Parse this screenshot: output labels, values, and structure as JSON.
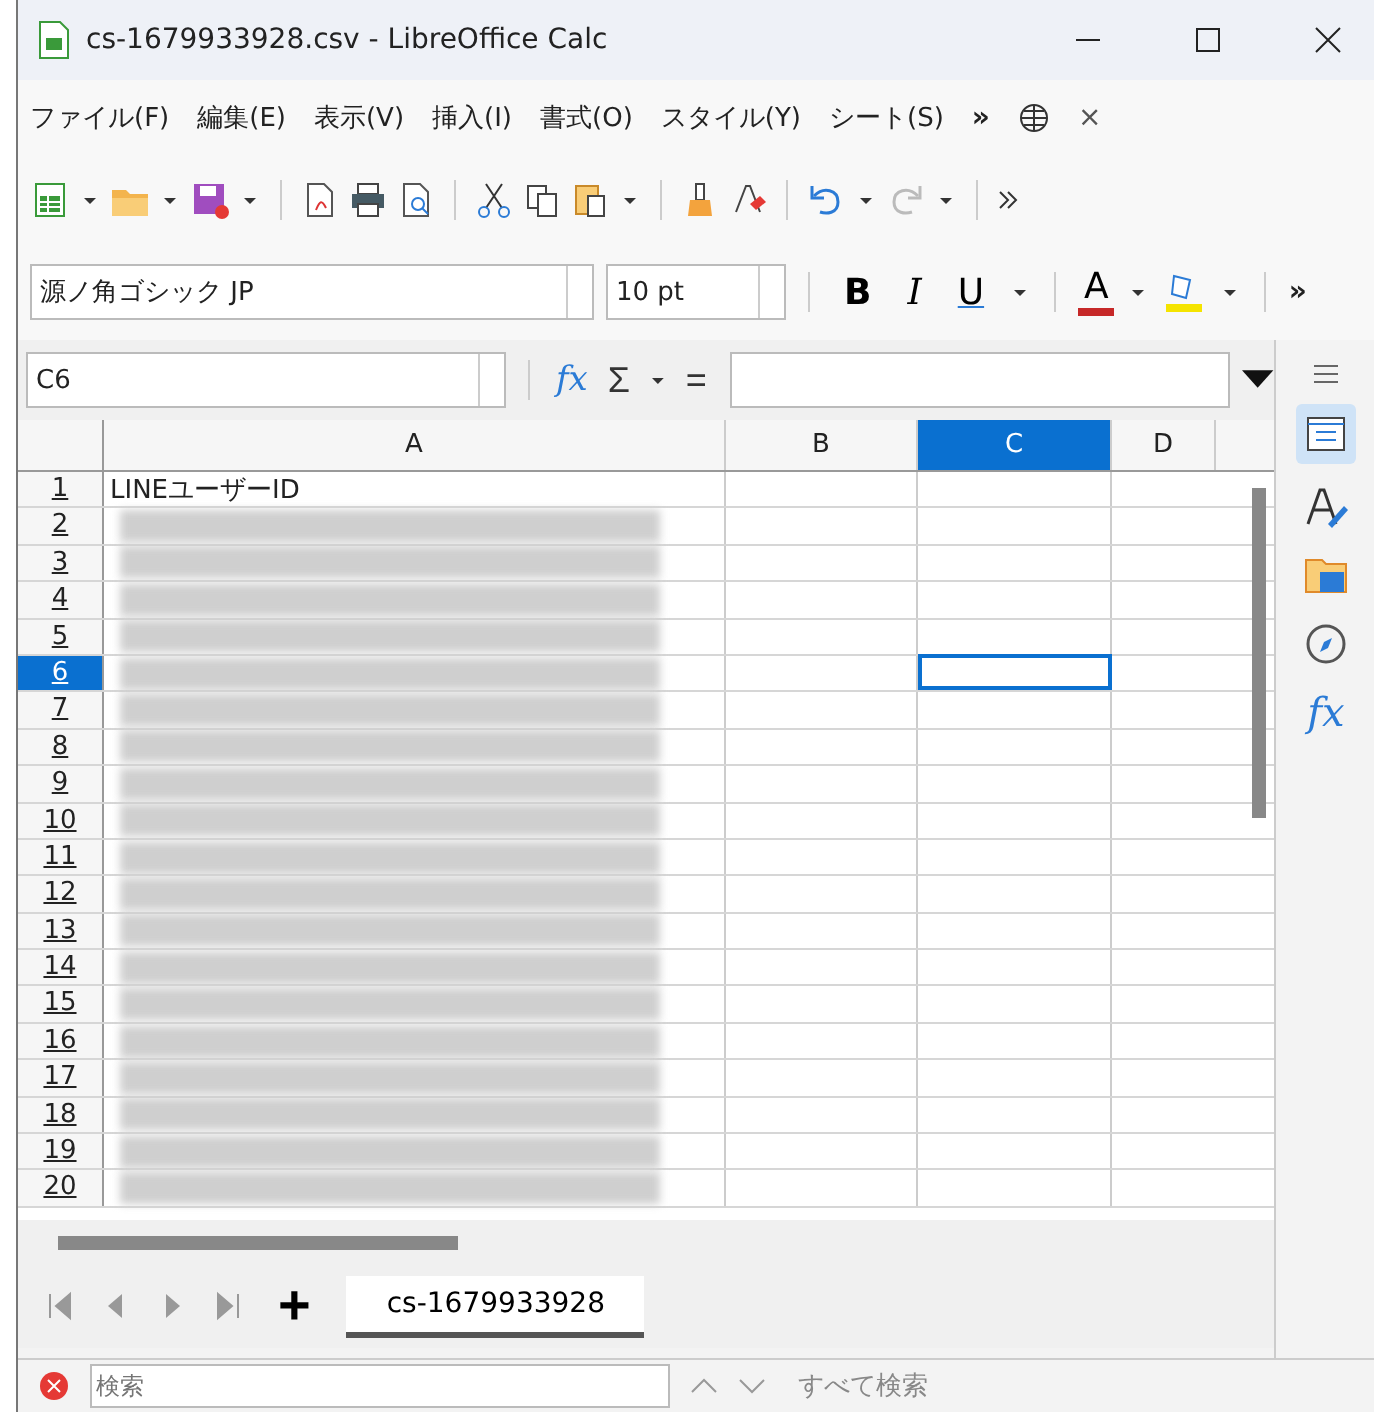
{
  "window": {
    "title": "cs-1679933928.csv - LibreOffice Calc"
  },
  "menu": {
    "items": [
      "ファイル(F)",
      "編集(E)",
      "表示(V)",
      "挿入(I)",
      "書式(O)",
      "スタイル(Y)",
      "シート(S)"
    ],
    "overflow": "»",
    "close": "×"
  },
  "format_toolbar": {
    "font_name": "源ノ角ゴシック JP",
    "font_size": "10 pt",
    "buttons": [
      "B",
      "I",
      "U"
    ],
    "font_color": "A",
    "overflow": "»"
  },
  "formula_bar": {
    "name_box": "C6",
    "function_wizard": "fx",
    "sum": "Σ",
    "equals": "="
  },
  "columns": [
    {
      "label": "A",
      "selected": false
    },
    {
      "label": "B",
      "selected": false
    },
    {
      "label": "C",
      "selected": true
    },
    {
      "label": "D",
      "selected": false
    }
  ],
  "rows": [
    {
      "number": "1",
      "selected": false,
      "redacted": false,
      "cell_a": "LINEユーザーID"
    },
    {
      "number": "2",
      "selected": false,
      "redacted": true
    },
    {
      "number": "3",
      "selected": false,
      "redacted": true
    },
    {
      "number": "4",
      "selected": false,
      "redacted": true
    },
    {
      "number": "5",
      "selected": false,
      "redacted": true
    },
    {
      "number": "6",
      "selected": true,
      "redacted": true
    },
    {
      "number": "7",
      "selected": false,
      "redacted": true
    },
    {
      "number": "8",
      "selected": false,
      "redacted": true
    },
    {
      "number": "9",
      "selected": false,
      "redacted": true
    },
    {
      "number": "10",
      "selected": false,
      "redacted": true
    },
    {
      "number": "11",
      "selected": false,
      "redacted": true
    },
    {
      "number": "12",
      "selected": false,
      "redacted": true
    },
    {
      "number": "13",
      "selected": false,
      "redacted": true
    },
    {
      "number": "14",
      "selected": false,
      "redacted": true
    },
    {
      "number": "15",
      "selected": false,
      "redacted": true
    },
    {
      "number": "16",
      "selected": false,
      "redacted": true
    },
    {
      "number": "17",
      "selected": false,
      "redacted": true
    },
    {
      "number": "18",
      "selected": false,
      "redacted": true
    },
    {
      "number": "19",
      "selected": false,
      "redacted": true
    },
    {
      "number": "20",
      "selected": false,
      "redacted": true
    }
  ],
  "sheet_tabs": {
    "add": "+",
    "tabs": [
      {
        "label": "cs-1679933928",
        "selected": true
      }
    ]
  },
  "sidebar": {
    "function_icon": "fx"
  },
  "find_bar": {
    "placeholder": "検索",
    "find_all": "すべて検索"
  }
}
